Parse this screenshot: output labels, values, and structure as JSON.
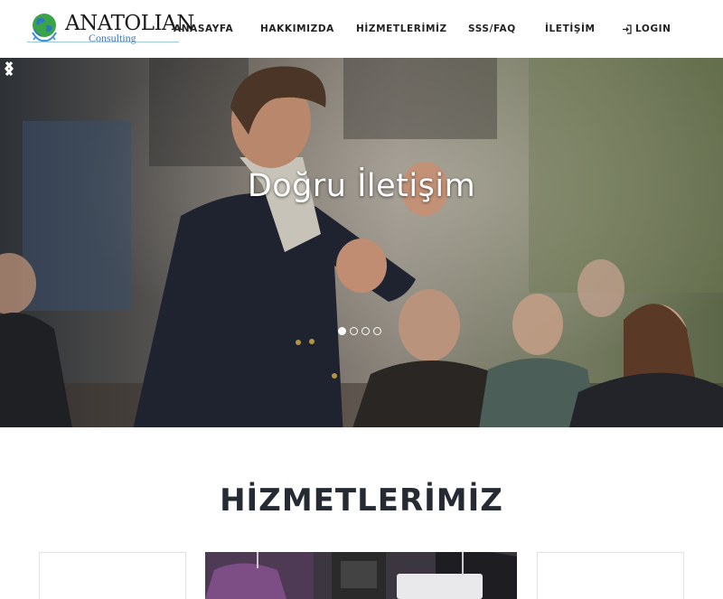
{
  "logo": {
    "name": "ANATOLIAN",
    "subtitle": "Consulting"
  },
  "nav": {
    "items": [
      {
        "label": "ANASAYFA"
      },
      {
        "label": "HAKKIMIZDA"
      },
      {
        "label": "HİZMETLERİMİZ"
      },
      {
        "label": "SSS/FAQ"
      },
      {
        "label": "İLETİŞİM"
      }
    ],
    "login": {
      "label": "LOGIN",
      "icon": "login-icon"
    }
  },
  "hero": {
    "caption": "Doğru İletişim",
    "prev_icon": "chevron-left-icon",
    "next_icon": "chevron-right-icon",
    "slide_count": 4,
    "active_slide": 1
  },
  "services": {
    "title": "HİZMETLERİMİZ"
  },
  "colors": {
    "title": "#252a33",
    "logo_blue": "#2f77c0",
    "globe_green": "#3aa547"
  }
}
